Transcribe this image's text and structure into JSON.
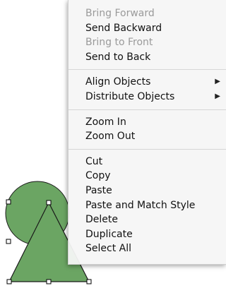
{
  "canvas": {
    "shape_fill": "#6ba563",
    "shape_stroke": "#1a1a1a",
    "handle_fill": "#ffffff"
  },
  "menu": {
    "groups": [
      [
        {
          "label": "Bring Forward",
          "enabled": false
        },
        {
          "label": "Send Backward",
          "enabled": true
        },
        {
          "label": "Bring to Front",
          "enabled": false
        },
        {
          "label": "Send to Back",
          "enabled": true
        }
      ],
      [
        {
          "label": "Align Objects",
          "enabled": true,
          "submenu": true
        },
        {
          "label": "Distribute Objects",
          "enabled": true,
          "submenu": true
        }
      ],
      [
        {
          "label": "Zoom In",
          "enabled": true
        },
        {
          "label": "Zoom Out",
          "enabled": true
        }
      ],
      [
        {
          "label": "Cut",
          "enabled": true
        },
        {
          "label": "Copy",
          "enabled": true
        },
        {
          "label": "Paste",
          "enabled": true
        },
        {
          "label": "Paste and Match Style",
          "enabled": true
        },
        {
          "label": "Delete",
          "enabled": true
        },
        {
          "label": "Duplicate",
          "enabled": true
        },
        {
          "label": "Select All",
          "enabled": true
        }
      ]
    ],
    "submenu_arrow": "▶"
  }
}
